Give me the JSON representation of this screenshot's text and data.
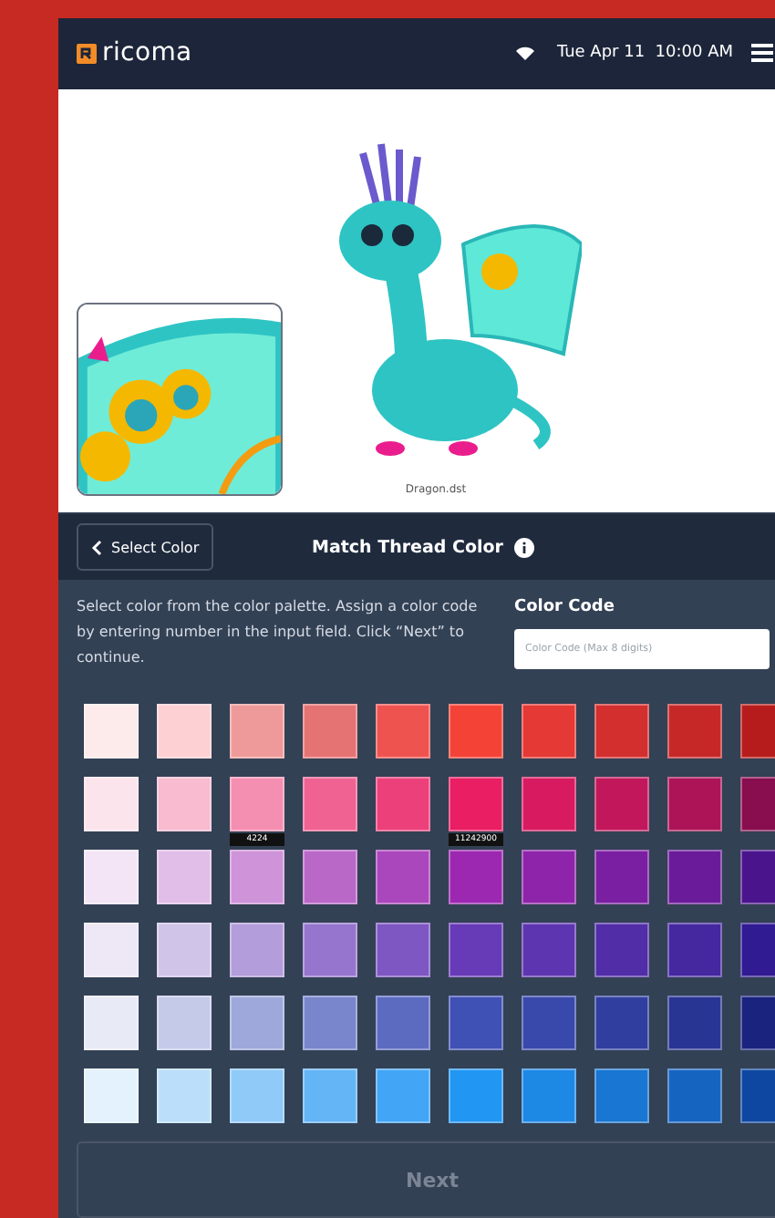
{
  "header": {
    "logo": "ricoma",
    "datetime": "Tue Apr 11  10:00 AM"
  },
  "preview": {
    "caption": "Dragon.dst"
  },
  "toolbar": {
    "back_button": "Select Color",
    "title": "Match Thread Color"
  },
  "instructions": "Select color from the color palette. Assign a color code by entering number in the input field. Click “Next” to continue.",
  "color_code": {
    "label": "Color Code",
    "placeholder": "Color Code (Max 8 digits)"
  },
  "palette": [
    {
      "swatches": [
        {
          "color": "#fdeaea"
        },
        {
          "color": "#fdd0d3"
        },
        {
          "color": "#ef9a9a"
        },
        {
          "color": "#e57373"
        },
        {
          "color": "#ef5350"
        },
        {
          "color": "#f44336"
        },
        {
          "color": "#e53935"
        },
        {
          "color": "#d32f2f"
        },
        {
          "color": "#c62828"
        },
        {
          "color": "#b71c1c"
        }
      ]
    },
    {
      "swatches": [
        {
          "color": "#fce4ec"
        },
        {
          "color": "#f8bbd0"
        },
        {
          "color": "#f48fb1",
          "code": "4224"
        },
        {
          "color": "#f06292"
        },
        {
          "color": "#ec407a"
        },
        {
          "color": "#e91e63",
          "code": "11242900"
        },
        {
          "color": "#d81b60"
        },
        {
          "color": "#c2185b"
        },
        {
          "color": "#ad1457"
        },
        {
          "color": "#880e4f"
        }
      ]
    },
    {
      "swatches": [
        {
          "color": "#f3e5f5"
        },
        {
          "color": "#e1bee7"
        },
        {
          "color": "#ce93d8"
        },
        {
          "color": "#ba68c8"
        },
        {
          "color": "#ab47bc"
        },
        {
          "color": "#9c27b0"
        },
        {
          "color": "#8e24aa"
        },
        {
          "color": "#7b1fa2"
        },
        {
          "color": "#6a1b9a"
        },
        {
          "color": "#4a148c"
        }
      ]
    },
    {
      "swatches": [
        {
          "color": "#ede7f6"
        },
        {
          "color": "#d1c4e9"
        },
        {
          "color": "#b39ddb"
        },
        {
          "color": "#9575cd"
        },
        {
          "color": "#7e57c2"
        },
        {
          "color": "#673ab7"
        },
        {
          "color": "#5e35b1"
        },
        {
          "color": "#512da8"
        },
        {
          "color": "#4527a0"
        },
        {
          "color": "#311b92"
        }
      ]
    },
    {
      "swatches": [
        {
          "color": "#e8eaf6"
        },
        {
          "color": "#c5cae9"
        },
        {
          "color": "#9fa8da"
        },
        {
          "color": "#7986cb"
        },
        {
          "color": "#5c6bc0"
        },
        {
          "color": "#3f51b5"
        },
        {
          "color": "#3949ab"
        },
        {
          "color": "#303f9f"
        },
        {
          "color": "#283593"
        },
        {
          "color": "#1a237e"
        }
      ]
    },
    {
      "swatches": [
        {
          "color": "#e3f2fd"
        },
        {
          "color": "#bbdefb"
        },
        {
          "color": "#90caf9"
        },
        {
          "color": "#64b5f6"
        },
        {
          "color": "#42a5f5"
        },
        {
          "color": "#2196f3"
        },
        {
          "color": "#1e88e5"
        },
        {
          "color": "#1976d2"
        },
        {
          "color": "#1565c0"
        },
        {
          "color": "#0d47a1"
        }
      ]
    }
  ],
  "next_button": {
    "label": "Next",
    "disabled": true
  }
}
